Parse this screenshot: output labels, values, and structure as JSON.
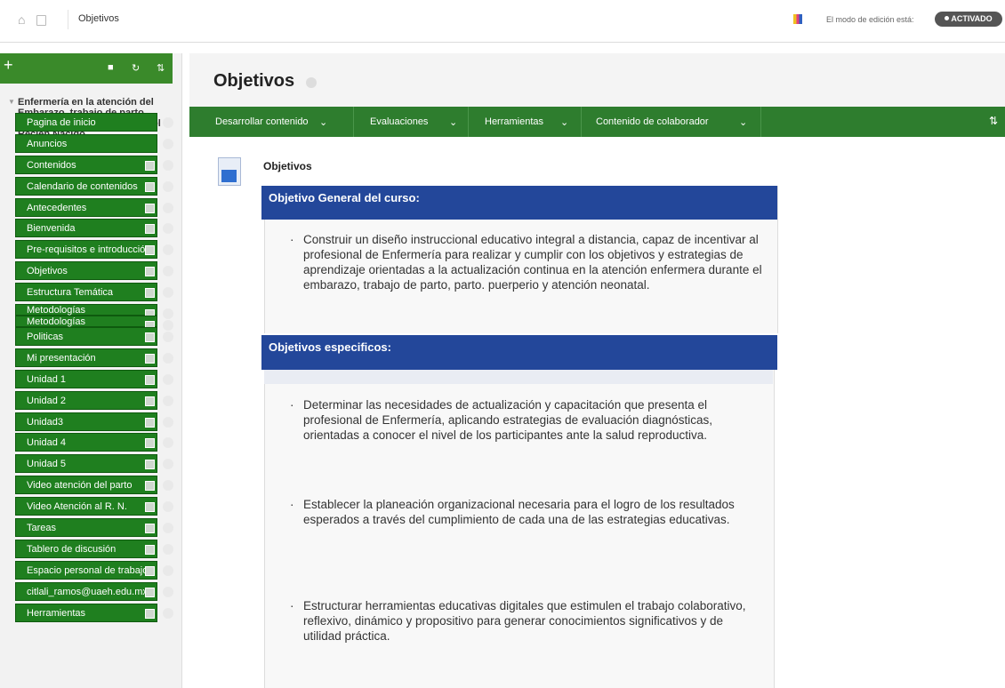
{
  "top": {
    "breadcrumb": "Objetivos",
    "edit_mode_label": "El modo de edición está:",
    "edit_mode_state": "ACTIVADO"
  },
  "course": {
    "title": "Enfermería en la atención del Embarazo. trabajo de parto, parto, puerperio y atención del Recién Nacido",
    "menu": [
      "Pagina de inicio",
      "Anuncios",
      "Contenidos",
      "Calendario de contenidos",
      "Antecedentes",
      "Bienvenida",
      "Pre-requisitos e introducción",
      "Objetivos",
      "Estructura Temática",
      "Metodologías",
      "Metodologías",
      "Politicas",
      "Mi presentación",
      "Unidad 1",
      "Unidad 2",
      "Unidad3",
      "Unidad 4",
      "Unidad 5",
      "Video atención del parto",
      "Video Atención al R. N.",
      "Tareas",
      "Tablero de discusión",
      "Espacio personal de trabajo",
      "citlali_ramos@uaeh.edu.mx",
      "Herramientas"
    ]
  },
  "page": {
    "title": "Objetivos",
    "actions": [
      "Desarrollar contenido",
      "Evaluaciones",
      "Herramientas",
      "Contenido de colaborador"
    ],
    "item_title": "Objetivos",
    "general_header": "Objetivo General del curso:",
    "general_text": "Construir un diseño instruccional educativo integral a distancia, capaz de incentivar al profesional de Enfermería para realizar y cumplir con los objetivos y estrategias de aprendizaje orientadas a la actualización continua en la atención enfermera durante el embarazo, trabajo de parto, parto. puerperio y atención neonatal.",
    "specific_header": "Objetivos especificos:",
    "specific": [
      "Determinar las necesidades de actualización y capacitación que presenta el profesional de Enfermería, aplicando estrategias de evaluación diagnósticas, orientadas a conocer el nivel de los participantes ante la salud reproductiva.",
      "Establecer la planeación organizacional necesaria para el logro de los resultados esperados a través del cumplimiento de cada una de las estrategias educativas.",
      "Estructurar herramientas educativas digitales que estimulen el trabajo colaborativo, reflexivo, dinámico y propositivo para generar conocimientos significativos y de utilidad práctica."
    ]
  }
}
